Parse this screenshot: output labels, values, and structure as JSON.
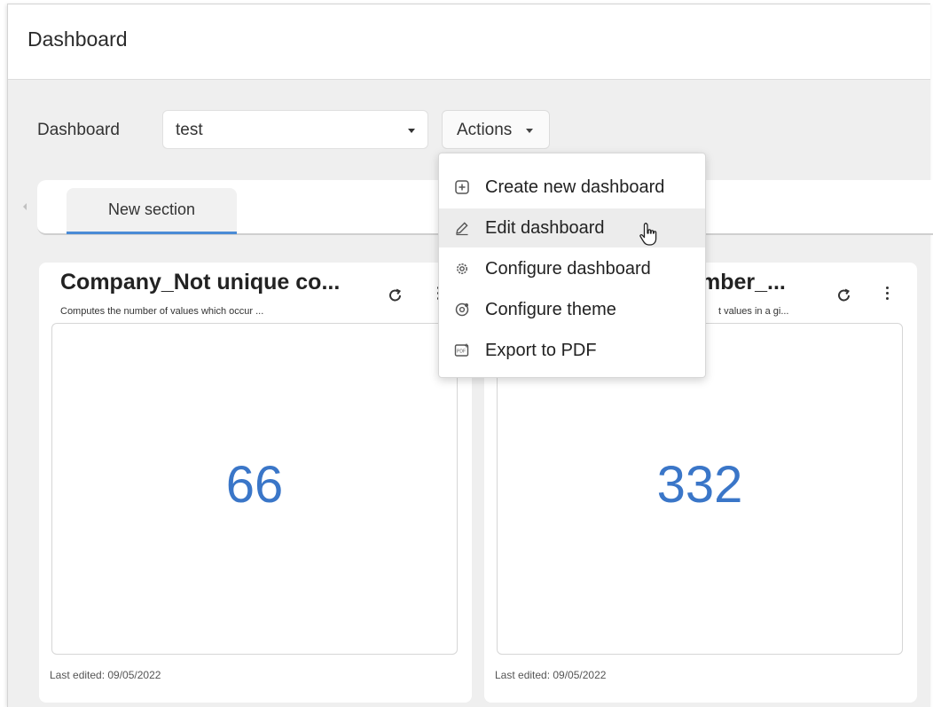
{
  "header": {
    "title": "Dashboard"
  },
  "filters": {
    "dashboard_label": "Dashboard",
    "dashboard_value": "test",
    "actions_label": "Actions"
  },
  "tabs": [
    {
      "label": "New section"
    }
  ],
  "actions_menu": {
    "items": [
      {
        "label": "Create new dashboard",
        "icon": "plus-box-icon"
      },
      {
        "label": "Edit dashboard",
        "icon": "pencil-icon"
      },
      {
        "label": "Configure dashboard",
        "icon": "gear-icon"
      },
      {
        "label": "Configure theme",
        "icon": "theme-gear-icon"
      },
      {
        "label": "Export to PDF",
        "icon": "pdf-icon"
      }
    ]
  },
  "cards": [
    {
      "title": "Company_Not unique co...",
      "subtitle": "Computes the number of values which occur ...",
      "value": "66",
      "footer": "Last edited: 09/05/2022"
    },
    {
      "title": "mber_...",
      "subtitle": "t values in a gi...",
      "value": "332",
      "footer": "Last edited: 09/05/2022"
    }
  ],
  "colors": {
    "accent": "#3a76c8",
    "tab_underline": "#4a8bd6"
  }
}
